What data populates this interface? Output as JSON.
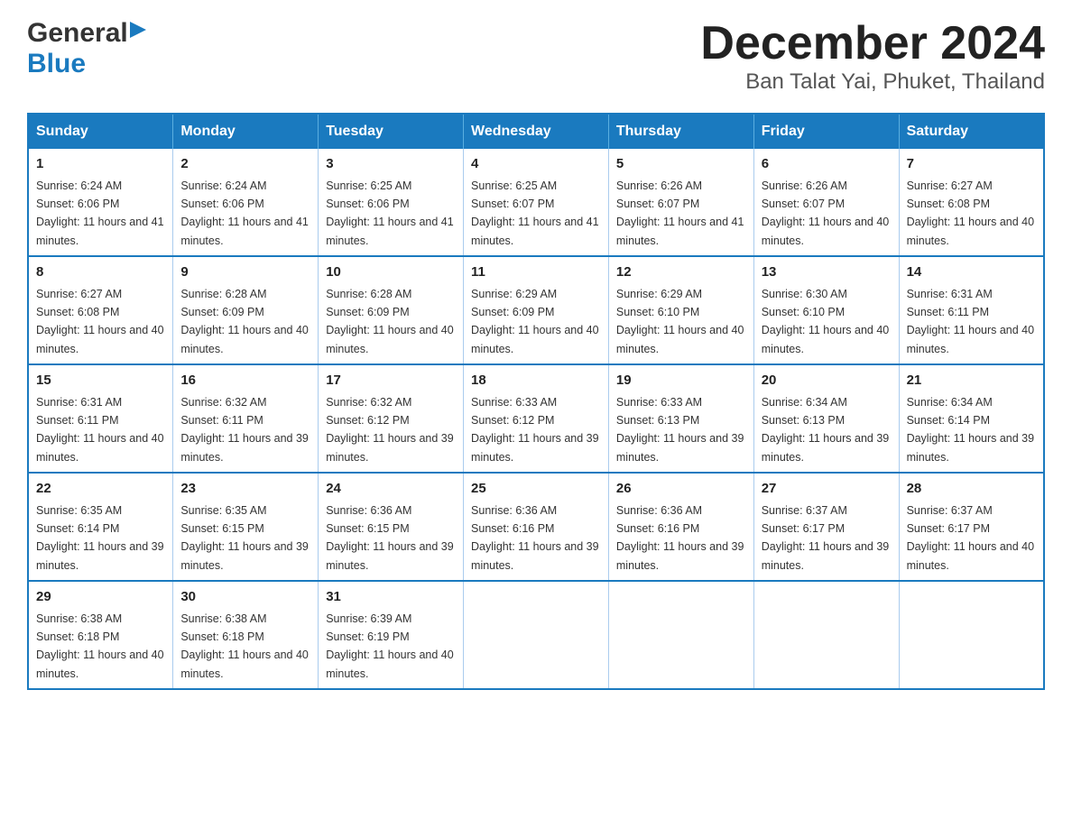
{
  "header": {
    "logo": {
      "general": "General",
      "blue": "Blue",
      "arrow": "▶"
    },
    "title": "December 2024",
    "location": "Ban Talat Yai, Phuket, Thailand"
  },
  "days_of_week": [
    "Sunday",
    "Monday",
    "Tuesday",
    "Wednesday",
    "Thursday",
    "Friday",
    "Saturday"
  ],
  "weeks": [
    [
      {
        "day": "1",
        "sunrise": "Sunrise: 6:24 AM",
        "sunset": "Sunset: 6:06 PM",
        "daylight": "Daylight: 11 hours and 41 minutes."
      },
      {
        "day": "2",
        "sunrise": "Sunrise: 6:24 AM",
        "sunset": "Sunset: 6:06 PM",
        "daylight": "Daylight: 11 hours and 41 minutes."
      },
      {
        "day": "3",
        "sunrise": "Sunrise: 6:25 AM",
        "sunset": "Sunset: 6:06 PM",
        "daylight": "Daylight: 11 hours and 41 minutes."
      },
      {
        "day": "4",
        "sunrise": "Sunrise: 6:25 AM",
        "sunset": "Sunset: 6:07 PM",
        "daylight": "Daylight: 11 hours and 41 minutes."
      },
      {
        "day": "5",
        "sunrise": "Sunrise: 6:26 AM",
        "sunset": "Sunset: 6:07 PM",
        "daylight": "Daylight: 11 hours and 41 minutes."
      },
      {
        "day": "6",
        "sunrise": "Sunrise: 6:26 AM",
        "sunset": "Sunset: 6:07 PM",
        "daylight": "Daylight: 11 hours and 40 minutes."
      },
      {
        "day": "7",
        "sunrise": "Sunrise: 6:27 AM",
        "sunset": "Sunset: 6:08 PM",
        "daylight": "Daylight: 11 hours and 40 minutes."
      }
    ],
    [
      {
        "day": "8",
        "sunrise": "Sunrise: 6:27 AM",
        "sunset": "Sunset: 6:08 PM",
        "daylight": "Daylight: 11 hours and 40 minutes."
      },
      {
        "day": "9",
        "sunrise": "Sunrise: 6:28 AM",
        "sunset": "Sunset: 6:09 PM",
        "daylight": "Daylight: 11 hours and 40 minutes."
      },
      {
        "day": "10",
        "sunrise": "Sunrise: 6:28 AM",
        "sunset": "Sunset: 6:09 PM",
        "daylight": "Daylight: 11 hours and 40 minutes."
      },
      {
        "day": "11",
        "sunrise": "Sunrise: 6:29 AM",
        "sunset": "Sunset: 6:09 PM",
        "daylight": "Daylight: 11 hours and 40 minutes."
      },
      {
        "day": "12",
        "sunrise": "Sunrise: 6:29 AM",
        "sunset": "Sunset: 6:10 PM",
        "daylight": "Daylight: 11 hours and 40 minutes."
      },
      {
        "day": "13",
        "sunrise": "Sunrise: 6:30 AM",
        "sunset": "Sunset: 6:10 PM",
        "daylight": "Daylight: 11 hours and 40 minutes."
      },
      {
        "day": "14",
        "sunrise": "Sunrise: 6:31 AM",
        "sunset": "Sunset: 6:11 PM",
        "daylight": "Daylight: 11 hours and 40 minutes."
      }
    ],
    [
      {
        "day": "15",
        "sunrise": "Sunrise: 6:31 AM",
        "sunset": "Sunset: 6:11 PM",
        "daylight": "Daylight: 11 hours and 40 minutes."
      },
      {
        "day": "16",
        "sunrise": "Sunrise: 6:32 AM",
        "sunset": "Sunset: 6:11 PM",
        "daylight": "Daylight: 11 hours and 39 minutes."
      },
      {
        "day": "17",
        "sunrise": "Sunrise: 6:32 AM",
        "sunset": "Sunset: 6:12 PM",
        "daylight": "Daylight: 11 hours and 39 minutes."
      },
      {
        "day": "18",
        "sunrise": "Sunrise: 6:33 AM",
        "sunset": "Sunset: 6:12 PM",
        "daylight": "Daylight: 11 hours and 39 minutes."
      },
      {
        "day": "19",
        "sunrise": "Sunrise: 6:33 AM",
        "sunset": "Sunset: 6:13 PM",
        "daylight": "Daylight: 11 hours and 39 minutes."
      },
      {
        "day": "20",
        "sunrise": "Sunrise: 6:34 AM",
        "sunset": "Sunset: 6:13 PM",
        "daylight": "Daylight: 11 hours and 39 minutes."
      },
      {
        "day": "21",
        "sunrise": "Sunrise: 6:34 AM",
        "sunset": "Sunset: 6:14 PM",
        "daylight": "Daylight: 11 hours and 39 minutes."
      }
    ],
    [
      {
        "day": "22",
        "sunrise": "Sunrise: 6:35 AM",
        "sunset": "Sunset: 6:14 PM",
        "daylight": "Daylight: 11 hours and 39 minutes."
      },
      {
        "day": "23",
        "sunrise": "Sunrise: 6:35 AM",
        "sunset": "Sunset: 6:15 PM",
        "daylight": "Daylight: 11 hours and 39 minutes."
      },
      {
        "day": "24",
        "sunrise": "Sunrise: 6:36 AM",
        "sunset": "Sunset: 6:15 PM",
        "daylight": "Daylight: 11 hours and 39 minutes."
      },
      {
        "day": "25",
        "sunrise": "Sunrise: 6:36 AM",
        "sunset": "Sunset: 6:16 PM",
        "daylight": "Daylight: 11 hours and 39 minutes."
      },
      {
        "day": "26",
        "sunrise": "Sunrise: 6:36 AM",
        "sunset": "Sunset: 6:16 PM",
        "daylight": "Daylight: 11 hours and 39 minutes."
      },
      {
        "day": "27",
        "sunrise": "Sunrise: 6:37 AM",
        "sunset": "Sunset: 6:17 PM",
        "daylight": "Daylight: 11 hours and 39 minutes."
      },
      {
        "day": "28",
        "sunrise": "Sunrise: 6:37 AM",
        "sunset": "Sunset: 6:17 PM",
        "daylight": "Daylight: 11 hours and 40 minutes."
      }
    ],
    [
      {
        "day": "29",
        "sunrise": "Sunrise: 6:38 AM",
        "sunset": "Sunset: 6:18 PM",
        "daylight": "Daylight: 11 hours and 40 minutes."
      },
      {
        "day": "30",
        "sunrise": "Sunrise: 6:38 AM",
        "sunset": "Sunset: 6:18 PM",
        "daylight": "Daylight: 11 hours and 40 minutes."
      },
      {
        "day": "31",
        "sunrise": "Sunrise: 6:39 AM",
        "sunset": "Sunset: 6:19 PM",
        "daylight": "Daylight: 11 hours and 40 minutes."
      },
      null,
      null,
      null,
      null
    ]
  ],
  "colors": {
    "header_bg": "#1a7abf",
    "border": "#1a7abf",
    "logo_blue": "#1a7abf"
  }
}
